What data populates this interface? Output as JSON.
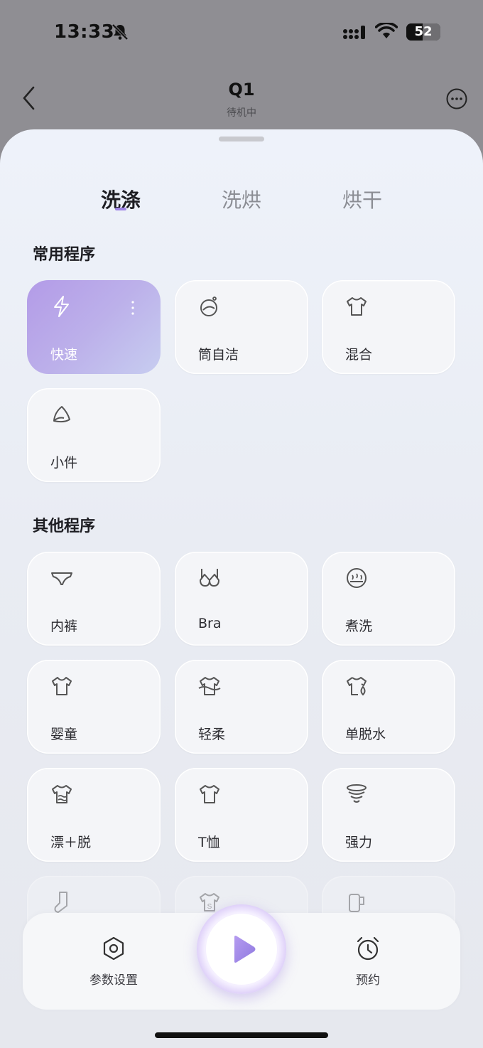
{
  "status_bar": {
    "time": "13:33",
    "battery": "52"
  },
  "header": {
    "title": "Q1",
    "subtitle": "待机中"
  },
  "tabs": [
    {
      "label": "洗涤",
      "active": true
    },
    {
      "label": "洗烘",
      "active": false
    },
    {
      "label": "烘干",
      "active": false
    }
  ],
  "common": {
    "title": "常用程序",
    "programs": [
      {
        "label": "快速",
        "icon": "lightning-icon",
        "selected": true
      },
      {
        "label": "筒自洁",
        "icon": "drum-clean-icon"
      },
      {
        "label": "混合",
        "icon": "shirt-icon"
      },
      {
        "label": "小件",
        "icon": "small-items-icon"
      }
    ]
  },
  "other": {
    "title": "其他程序",
    "programs": [
      {
        "label": "内裤",
        "icon": "underwear-icon"
      },
      {
        "label": "Bra",
        "icon": "bra-icon"
      },
      {
        "label": "煮洗",
        "icon": "boil-wash-icon"
      },
      {
        "label": "婴童",
        "icon": "baby-shirt-icon"
      },
      {
        "label": "轻柔",
        "icon": "gentle-shirt-icon"
      },
      {
        "label": "单脱水",
        "icon": "spin-only-icon"
      },
      {
        "label": "漂＋脱",
        "icon": "rinse-spin-icon"
      },
      {
        "label": "T恤",
        "icon": "tshirt-icon"
      },
      {
        "label": "强力",
        "icon": "heavy-duty-icon"
      },
      {
        "label": "",
        "icon": "sock-icon"
      },
      {
        "label": "",
        "icon": "sport-shirt-icon"
      },
      {
        "label": "",
        "icon": "towel-icon"
      }
    ]
  },
  "bottom_bar": {
    "settings_label": "参数设置",
    "schedule_label": "预约"
  },
  "colors": {
    "accent": "#9e84e6",
    "selected_card": "#b39be7"
  }
}
